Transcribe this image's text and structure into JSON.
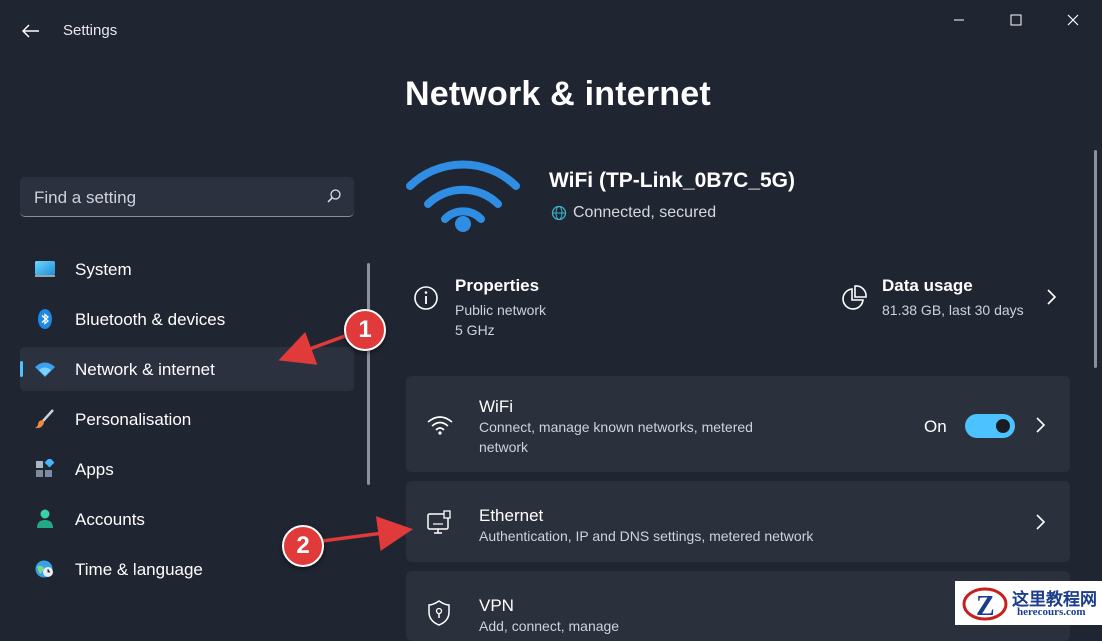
{
  "window": {
    "title": "Settings",
    "controls": [
      "minimize",
      "maximize",
      "close"
    ]
  },
  "search": {
    "placeholder": "Find a setting"
  },
  "sidebar": {
    "items": [
      {
        "label": "System",
        "icon": "monitor-icon",
        "active": false
      },
      {
        "label": "Bluetooth & devices",
        "icon": "bluetooth-icon",
        "active": false
      },
      {
        "label": "Network & internet",
        "icon": "wifi-icon",
        "active": true
      },
      {
        "label": "Personalisation",
        "icon": "brush-icon",
        "active": false
      },
      {
        "label": "Apps",
        "icon": "apps-icon",
        "active": false
      },
      {
        "label": "Accounts",
        "icon": "person-icon",
        "active": false
      },
      {
        "label": "Time & language",
        "icon": "globe-clock-icon",
        "active": false
      }
    ]
  },
  "main": {
    "title": "Network & internet",
    "network": {
      "name": "WiFi (TP-Link_0B7C_5G)",
      "status": "Connected, secured"
    },
    "properties": {
      "title": "Properties",
      "lines": [
        "Public network",
        "5 GHz"
      ]
    },
    "data_usage": {
      "title": "Data usage",
      "value": "81.38 GB, last 30 days"
    },
    "cards": [
      {
        "title": "WiFi",
        "desc_lines": [
          "Connect, manage known networks, metered",
          "network"
        ],
        "toggle_label": "On",
        "toggle_on": true
      },
      {
        "title": "Ethernet",
        "desc_lines": [
          "Authentication, IP and DNS settings, metered network"
        ]
      },
      {
        "title": "VPN",
        "desc_lines": [
          "Add, connect, manage"
        ]
      }
    ]
  },
  "annotations": {
    "step1": "1",
    "step2": "2"
  },
  "watermark": {
    "cn": "这里教程网",
    "en": "herecours.com",
    "logo_letter": "Z"
  },
  "colors": {
    "background": "#202532",
    "card": "#2b303d",
    "accent": "#4cc2ff",
    "annotation": "#e03a3a"
  }
}
